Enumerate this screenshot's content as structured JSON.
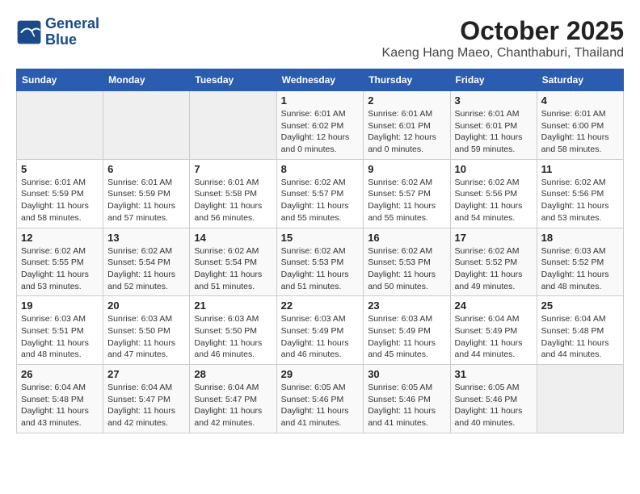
{
  "header": {
    "logo_line1": "General",
    "logo_line2": "Blue",
    "title": "October 2025",
    "subtitle": "Kaeng Hang Maeo, Chanthaburi, Thailand"
  },
  "weekdays": [
    "Sunday",
    "Monday",
    "Tuesday",
    "Wednesday",
    "Thursday",
    "Friday",
    "Saturday"
  ],
  "weeks": [
    [
      {
        "day": "",
        "info": ""
      },
      {
        "day": "",
        "info": ""
      },
      {
        "day": "",
        "info": ""
      },
      {
        "day": "1",
        "info": "Sunrise: 6:01 AM\nSunset: 6:02 PM\nDaylight: 12 hours\nand 0 minutes."
      },
      {
        "day": "2",
        "info": "Sunrise: 6:01 AM\nSunset: 6:01 PM\nDaylight: 12 hours\nand 0 minutes."
      },
      {
        "day": "3",
        "info": "Sunrise: 6:01 AM\nSunset: 6:01 PM\nDaylight: 11 hours\nand 59 minutes."
      },
      {
        "day": "4",
        "info": "Sunrise: 6:01 AM\nSunset: 6:00 PM\nDaylight: 11 hours\nand 58 minutes."
      }
    ],
    [
      {
        "day": "5",
        "info": "Sunrise: 6:01 AM\nSunset: 5:59 PM\nDaylight: 11 hours\nand 58 minutes."
      },
      {
        "day": "6",
        "info": "Sunrise: 6:01 AM\nSunset: 5:59 PM\nDaylight: 11 hours\nand 57 minutes."
      },
      {
        "day": "7",
        "info": "Sunrise: 6:01 AM\nSunset: 5:58 PM\nDaylight: 11 hours\nand 56 minutes."
      },
      {
        "day": "8",
        "info": "Sunrise: 6:02 AM\nSunset: 5:57 PM\nDaylight: 11 hours\nand 55 minutes."
      },
      {
        "day": "9",
        "info": "Sunrise: 6:02 AM\nSunset: 5:57 PM\nDaylight: 11 hours\nand 55 minutes."
      },
      {
        "day": "10",
        "info": "Sunrise: 6:02 AM\nSunset: 5:56 PM\nDaylight: 11 hours\nand 54 minutes."
      },
      {
        "day": "11",
        "info": "Sunrise: 6:02 AM\nSunset: 5:56 PM\nDaylight: 11 hours\nand 53 minutes."
      }
    ],
    [
      {
        "day": "12",
        "info": "Sunrise: 6:02 AM\nSunset: 5:55 PM\nDaylight: 11 hours\nand 53 minutes."
      },
      {
        "day": "13",
        "info": "Sunrise: 6:02 AM\nSunset: 5:54 PM\nDaylight: 11 hours\nand 52 minutes."
      },
      {
        "day": "14",
        "info": "Sunrise: 6:02 AM\nSunset: 5:54 PM\nDaylight: 11 hours\nand 51 minutes."
      },
      {
        "day": "15",
        "info": "Sunrise: 6:02 AM\nSunset: 5:53 PM\nDaylight: 11 hours\nand 51 minutes."
      },
      {
        "day": "16",
        "info": "Sunrise: 6:02 AM\nSunset: 5:53 PM\nDaylight: 11 hours\nand 50 minutes."
      },
      {
        "day": "17",
        "info": "Sunrise: 6:02 AM\nSunset: 5:52 PM\nDaylight: 11 hours\nand 49 minutes."
      },
      {
        "day": "18",
        "info": "Sunrise: 6:03 AM\nSunset: 5:52 PM\nDaylight: 11 hours\nand 48 minutes."
      }
    ],
    [
      {
        "day": "19",
        "info": "Sunrise: 6:03 AM\nSunset: 5:51 PM\nDaylight: 11 hours\nand 48 minutes."
      },
      {
        "day": "20",
        "info": "Sunrise: 6:03 AM\nSunset: 5:50 PM\nDaylight: 11 hours\nand 47 minutes."
      },
      {
        "day": "21",
        "info": "Sunrise: 6:03 AM\nSunset: 5:50 PM\nDaylight: 11 hours\nand 46 minutes."
      },
      {
        "day": "22",
        "info": "Sunrise: 6:03 AM\nSunset: 5:49 PM\nDaylight: 11 hours\nand 46 minutes."
      },
      {
        "day": "23",
        "info": "Sunrise: 6:03 AM\nSunset: 5:49 PM\nDaylight: 11 hours\nand 45 minutes."
      },
      {
        "day": "24",
        "info": "Sunrise: 6:04 AM\nSunset: 5:49 PM\nDaylight: 11 hours\nand 44 minutes."
      },
      {
        "day": "25",
        "info": "Sunrise: 6:04 AM\nSunset: 5:48 PM\nDaylight: 11 hours\nand 44 minutes."
      }
    ],
    [
      {
        "day": "26",
        "info": "Sunrise: 6:04 AM\nSunset: 5:48 PM\nDaylight: 11 hours\nand 43 minutes."
      },
      {
        "day": "27",
        "info": "Sunrise: 6:04 AM\nSunset: 5:47 PM\nDaylight: 11 hours\nand 42 minutes."
      },
      {
        "day": "28",
        "info": "Sunrise: 6:04 AM\nSunset: 5:47 PM\nDaylight: 11 hours\nand 42 minutes."
      },
      {
        "day": "29",
        "info": "Sunrise: 6:05 AM\nSunset: 5:46 PM\nDaylight: 11 hours\nand 41 minutes."
      },
      {
        "day": "30",
        "info": "Sunrise: 6:05 AM\nSunset: 5:46 PM\nDaylight: 11 hours\nand 41 minutes."
      },
      {
        "day": "31",
        "info": "Sunrise: 6:05 AM\nSunset: 5:46 PM\nDaylight: 11 hours\nand 40 minutes."
      },
      {
        "day": "",
        "info": ""
      }
    ]
  ]
}
